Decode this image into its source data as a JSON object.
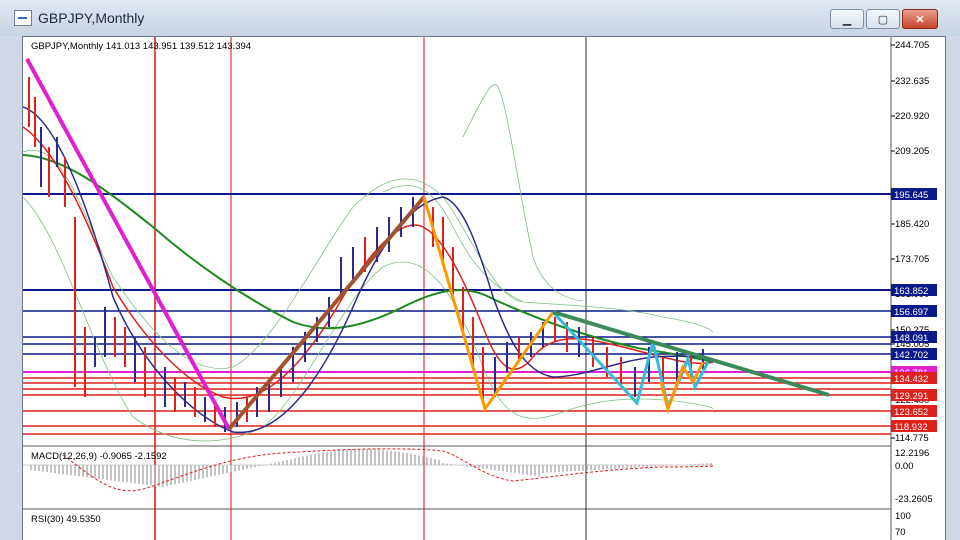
{
  "window": {
    "title": "GBPJPY,Monthly",
    "minimize_icon": "minimize-icon",
    "maximize_icon": "maximize-icon",
    "close_icon": "close-icon"
  },
  "chart": {
    "header": "GBPJPY,Monthly  141.013 143.951 139.512 143.394",
    "price_axis": [
      "244.705",
      "232.635",
      "220.920",
      "209.205",
      "185.420",
      "173.705",
      "161.990",
      "150.275",
      "145.005",
      "134.432",
      "122.480",
      "114.775"
    ],
    "price_labels": [
      {
        "text": "195.645",
        "color": "#0a1a8a"
      },
      {
        "text": "163.852",
        "color": "#0a1a8a"
      },
      {
        "text": "156.697",
        "color": "#0a1a8a"
      },
      {
        "text": "148.091",
        "color": "#0a1a8a"
      },
      {
        "text": "142.702",
        "color": "#0a1a8a"
      },
      {
        "text": "136.781",
        "color": "#e020d0"
      },
      {
        "text": "134.432",
        "color": "#e0201a"
      },
      {
        "text": "129.291",
        "color": "#e0201a"
      },
      {
        "text": "123.652",
        "color": "#e0201a"
      },
      {
        "text": "118.932",
        "color": "#e0201a"
      }
    ]
  },
  "macd": {
    "label": "MACD(12,26,9) -0.9065 -2.1592",
    "axis": [
      "12.2196",
      "0.00",
      "-23.2605"
    ]
  },
  "rsi": {
    "label": "RSI(30) 49.5350",
    "axis": [
      "100",
      "70"
    ]
  },
  "colors": {
    "background": "#ffffff",
    "support_red": "#e0201a",
    "resistance_blue": "#0a1a8a",
    "trend_magenta": "#e020d0",
    "trend_brown": "#a0522d",
    "trend_orange": "#ff9900",
    "trend_cyan": "#33bbdd",
    "trend_green": "#3a8a5a"
  }
}
